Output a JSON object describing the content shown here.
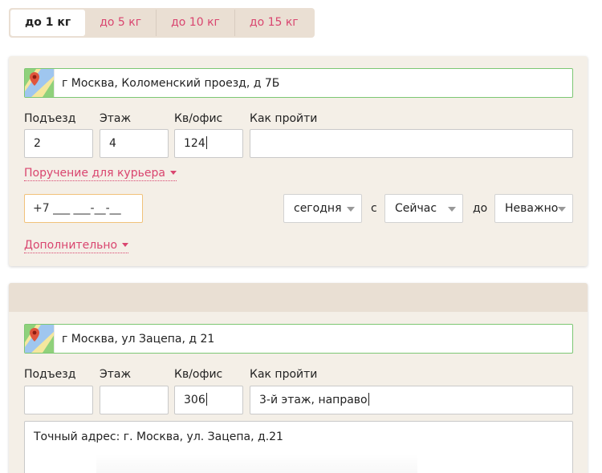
{
  "tabs": [
    {
      "label": "до 1 кг",
      "active": true
    },
    {
      "label": "до 5 кг",
      "active": false
    },
    {
      "label": "до 10 кг",
      "active": false
    },
    {
      "label": "до 15 кг",
      "active": false
    }
  ],
  "point1": {
    "address": "г Москва, Коломенский проезд, д 7Б",
    "labels": {
      "entrance": "Подъезд",
      "floor": "Этаж",
      "apt": "Кв/офис",
      "howto": "Как пройти"
    },
    "entrance": "2",
    "floor": "4",
    "apt": "124",
    "howto": "",
    "courier_task_link": "Поручение для курьера",
    "phone": "+7 ___ ___-__-__",
    "day_select": "сегодня",
    "from_word": "с",
    "from_select": "Сейчас",
    "to_word": "до",
    "to_select": "Неважно",
    "more_link": "Дополнительно"
  },
  "point2": {
    "address": "г Москва, ул Зацепа, д 21",
    "labels": {
      "entrance": "Подъезд",
      "floor": "Этаж",
      "apt": "Кв/офис",
      "howto": "Как пройти"
    },
    "entrance": "",
    "floor": "",
    "apt": "306",
    "howto": "3-й этаж, направо",
    "note": "Точный адрес: г. Москва, ул. Зацепа, д.21"
  },
  "colors": {
    "accent": "#d9456f",
    "card_bg": "#f4efe7",
    "address_border": "#7cc773",
    "phone_border": "#f1c27a"
  }
}
